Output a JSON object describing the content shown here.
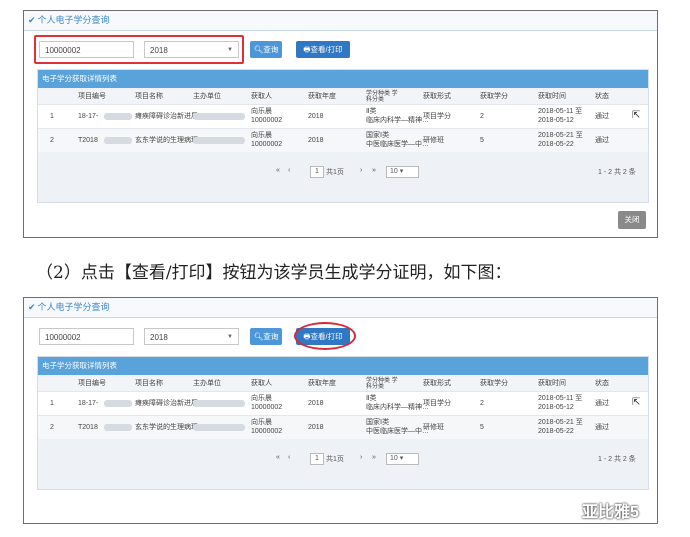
{
  "panel": {
    "title": "个人电子学分查询"
  },
  "search": {
    "code_value": "10000002",
    "year_value": "2018",
    "search_label": "查询",
    "print_label": "查看/打印"
  },
  "list": {
    "title": "电子学分获取详情列表",
    "headers": [
      "项目编号",
      "项目名称",
      "主办单位",
      "获取人",
      "获取年度",
      "学分种类 学科分类",
      "获取形式",
      "获取学分",
      "获取时间",
      "状态"
    ],
    "rows": [
      {
        "idx": "1",
        "code": "18-17-",
        "name": "瘫痪障碍诊治新进展",
        "person1": "向乐晨",
        "person2": "10000002",
        "year": "2018",
        "kind1": "Ⅱ类",
        "kind2": "临床内科学—精神…",
        "form": "项目学分",
        "credit": "2",
        "time1": "2018-05-11 至",
        "time2": "2018-05-12",
        "status": "通过"
      },
      {
        "idx": "2",
        "code": "T2018",
        "name": "玄东学说的生理病理",
        "person1": "向乐晨",
        "person2": "10000002",
        "year": "2018",
        "kind1": "国家Ⅰ类",
        "kind2": "中医临床医学—中…",
        "form": "研修班",
        "credit": "5",
        "time1": "2018-05-21 至",
        "time2": "2018-05-22",
        "status": "通过"
      }
    ]
  },
  "pager": {
    "page": "1",
    "total_pages": "共1页",
    "page_size": "10",
    "summary": "1 - 2  共 2 条"
  },
  "close_label": "关闭",
  "caption": "（2）点击【查看/打印】按钮为该学员生成学分证明，如下图：",
  "watermark": "亚比雅5"
}
